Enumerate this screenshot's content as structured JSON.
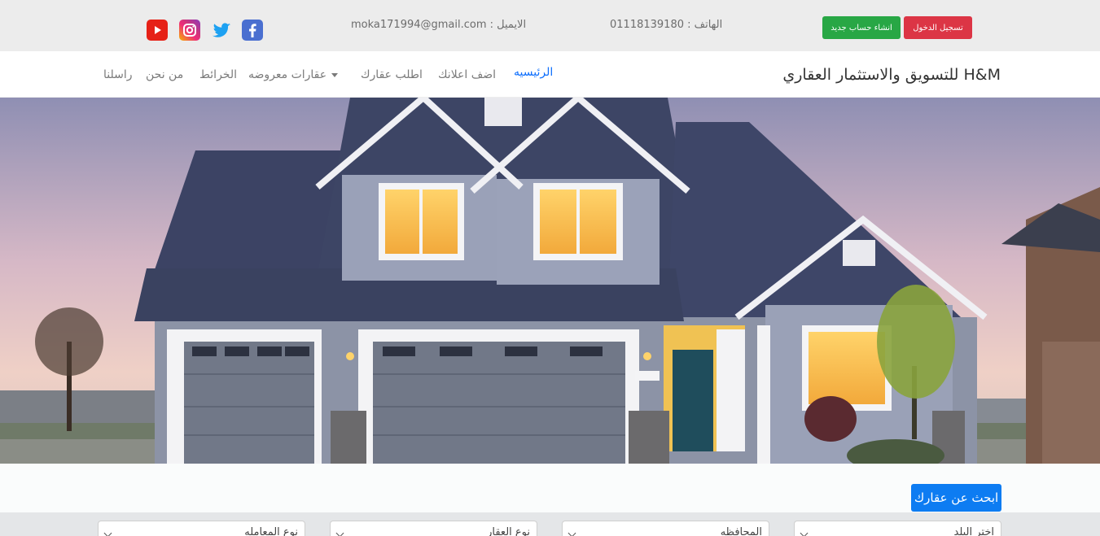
{
  "topbar": {
    "email": "الايميل : moka171994@gmail.com",
    "phone": "الهاتف : 01118139180",
    "register_label": "انشاء حساب جديد",
    "login_label": "تسجيل الدخول",
    "social": [
      "youtube-icon",
      "instagram-icon",
      "twitter-icon",
      "facebook-icon"
    ]
  },
  "navbar": {
    "brand": "H&M للتسويق والاستثمار العقاري",
    "items": [
      {
        "label": "الرئيسيه"
      },
      {
        "label": "اضف اعلانك"
      },
      {
        "label": "اطلب عقارك"
      },
      {
        "label": "عقارات معروضه"
      },
      {
        "label": "الخرائط"
      },
      {
        "label": "من نحن"
      },
      {
        "label": "راسلنا"
      }
    ]
  },
  "search": {
    "button_label": "ابحث عن عقارك",
    "filters": [
      "نوع المعامله",
      "نوع العقار",
      "المحافظه",
      "اختر البلد"
    ]
  },
  "colors": {
    "login": "#dc3545",
    "register": "#28a745",
    "active_nav": "#0d6efd",
    "search_button": "#0d7cf2"
  }
}
